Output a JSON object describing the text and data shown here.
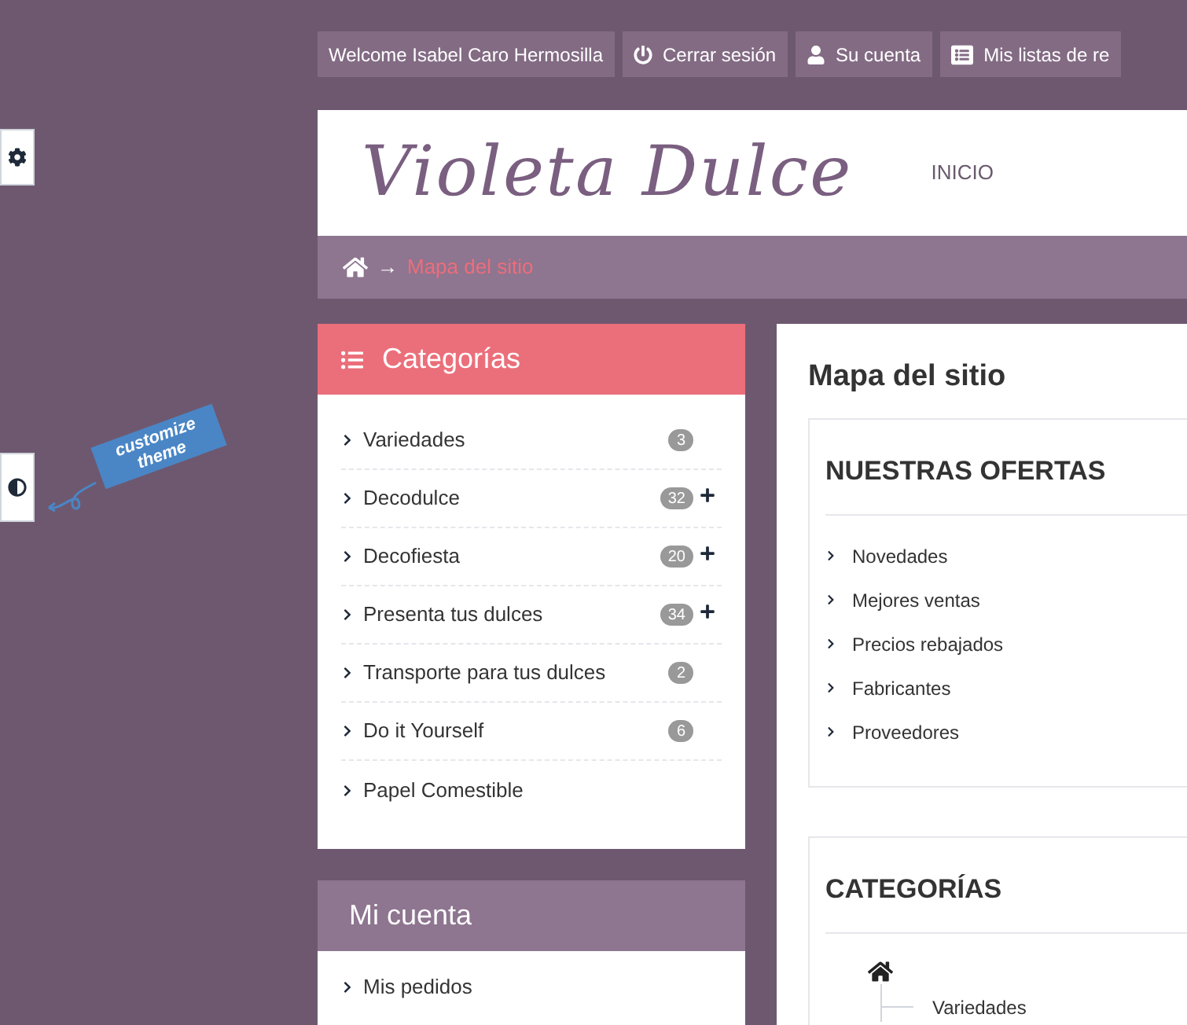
{
  "top_nav": [
    {
      "kind": "text",
      "label": "Welcome Isabel Caro Hermosilla"
    },
    {
      "kind": "power",
      "label": "Cerrar sesión"
    },
    {
      "kind": "user",
      "label": "Su cuenta"
    },
    {
      "kind": "list",
      "label": "Mis listas de re"
    }
  ],
  "header": {
    "logo": "Violeta Dulce",
    "menu": [
      "INICIO"
    ]
  },
  "breadcrumb": {
    "current": "Mapa del sitio",
    "separator": "→"
  },
  "side_widgets": {
    "tag": "customize theme"
  },
  "categories_block": {
    "title": "Categorías",
    "items": [
      {
        "label": "Variedades",
        "count": "3",
        "expandable": false
      },
      {
        "label": "Decodulce",
        "count": "32",
        "expandable": true
      },
      {
        "label": "Decofiesta",
        "count": "20",
        "expandable": true
      },
      {
        "label": "Presenta tus dulces",
        "count": "34",
        "expandable": true
      },
      {
        "label": "Transporte para tus dulces",
        "count": "2",
        "expandable": false
      },
      {
        "label": "Do it Yourself",
        "count": "6",
        "expandable": false
      },
      {
        "label": "Papel Comestible",
        "expandable": false
      }
    ]
  },
  "account_block": {
    "title": "Mi cuenta",
    "items": [
      "Mis pedidos"
    ]
  },
  "main": {
    "title": "Mapa del sitio",
    "offers": {
      "title": "NUESTRAS OFERTAS",
      "items": [
        "Novedades",
        "Mejores ventas",
        "Precios rebajados",
        "Fabricantes",
        "Proveedores"
      ]
    },
    "categories": {
      "title": "CATEGORÍAS",
      "tree": [
        "Variedades"
      ]
    }
  }
}
